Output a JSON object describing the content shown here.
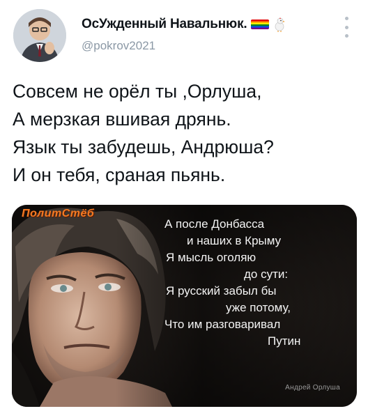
{
  "tweet": {
    "author": {
      "display_name": "ОсУжденный Навальнюк.",
      "handle": "@pokrov2021",
      "badge_icons": [
        "rainbow-flag-icon",
        "chick-icon"
      ]
    },
    "more_icon": "more-vertical-icon",
    "text_lines": [
      "Совсем не орёл ты ,Орлуша,",
      "А мерзкая вшивая дрянь.",
      "Язык ты забудешь, Андрюша?",
      "И он тебя, сраная пьянь."
    ],
    "media": {
      "watermark_top": "ПолитСтёб",
      "poem_lines": [
        "А после Донбасса",
        "и наших в Крыму",
        "Я мысль оголяю",
        "до сути:",
        "Я русский забыл бы",
        "уже потому,",
        "Что им разговаривал",
        "Путин"
      ],
      "signature": "Андрей Орлуша"
    }
  },
  "colors": {
    "text": "#0f1419",
    "secondary": "#8b98a5",
    "watermark": "#f47a23"
  }
}
